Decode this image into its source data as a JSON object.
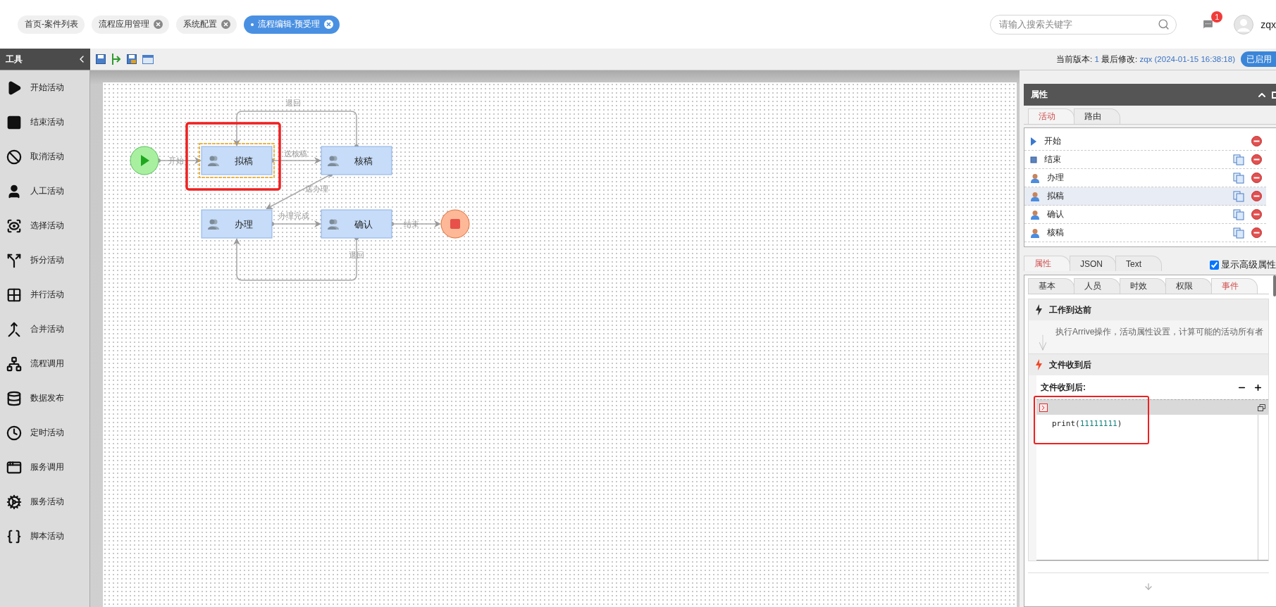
{
  "tabs": [
    {
      "label": "首页-案件列表",
      "closable": false,
      "selected": false
    },
    {
      "label": "流程应用管理",
      "closable": true,
      "selected": false
    },
    {
      "label": "系统配置",
      "closable": true,
      "selected": false
    },
    {
      "label": "流程编辑-预受理",
      "closable": true,
      "selected": true
    }
  ],
  "search": {
    "placeholder": "请输入搜索关键字"
  },
  "notifications": {
    "count": "1"
  },
  "user": {
    "name": "zqx"
  },
  "toolbox": {
    "title": "工具",
    "items": [
      "开始活动",
      "结束活动",
      "取消活动",
      "人工活动",
      "选择活动",
      "拆分活动",
      "并行活动",
      "合并活动",
      "流程调用",
      "数据发布",
      "定时活动",
      "服务调用",
      "服务活动",
      "脚本活动"
    ]
  },
  "version_bar": {
    "version_label": "当前版本:",
    "version": "1",
    "modified_label": "最后修改:",
    "modified": "zqx (2024-01-15 16:38:18)",
    "status": "已启用"
  },
  "diagram": {
    "nodes": [
      {
        "kind": "start",
        "selected": false
      },
      {
        "kind": "task",
        "label": "拟稿",
        "selected": true
      },
      {
        "kind": "task",
        "label": "核稿",
        "selected": false
      },
      {
        "kind": "task",
        "label": "办理",
        "selected": false
      },
      {
        "kind": "task",
        "label": "确认",
        "selected": false
      },
      {
        "kind": "end",
        "selected": false
      }
    ],
    "edges": [
      {
        "label": "退回"
      },
      {
        "label": "开始"
      },
      {
        "label": "送核稿"
      },
      {
        "label": "送办理"
      },
      {
        "label": "办理完成"
      },
      {
        "label": "结束"
      },
      {
        "label": "退回"
      }
    ]
  },
  "properties": {
    "title": "属性",
    "list_tabs": [
      {
        "label": "活动",
        "selected": true
      },
      {
        "label": "路由",
        "selected": false
      }
    ],
    "activities": [
      {
        "kind": "start",
        "label": "开始",
        "copyable": false,
        "selected": false
      },
      {
        "kind": "end",
        "label": "结束",
        "copyable": true,
        "selected": false
      },
      {
        "kind": "task",
        "label": "办理",
        "copyable": true,
        "selected": false
      },
      {
        "kind": "task",
        "label": "拟稿",
        "copyable": true,
        "selected": true
      },
      {
        "kind": "task",
        "label": "确认",
        "copyable": true,
        "selected": false
      },
      {
        "kind": "task",
        "label": "核稿",
        "copyable": true,
        "selected": false
      }
    ],
    "view_tabs": [
      {
        "label": "属性",
        "selected": true
      },
      {
        "label": "JSON",
        "selected": false
      },
      {
        "label": "Text",
        "selected": false
      }
    ],
    "advanced": {
      "label": "显示高级属性",
      "checked": true
    },
    "detail_tabs": [
      {
        "label": "基本",
        "selected": false
      },
      {
        "label": "人员",
        "selected": false
      },
      {
        "label": "时效",
        "selected": false
      },
      {
        "label": "权限",
        "selected": false
      },
      {
        "label": "事件",
        "selected": true
      }
    ],
    "events": [
      {
        "title": "工作到达前",
        "active": false,
        "description": "执行Arrive操作，活动属性设置，计算可能的活动所有者"
      },
      {
        "title": "文件收到后",
        "active": true,
        "editor_label": "文件收到后:",
        "code_fn": "print(",
        "code_arg": "11111111",
        "code_end": ")"
      }
    ]
  }
}
